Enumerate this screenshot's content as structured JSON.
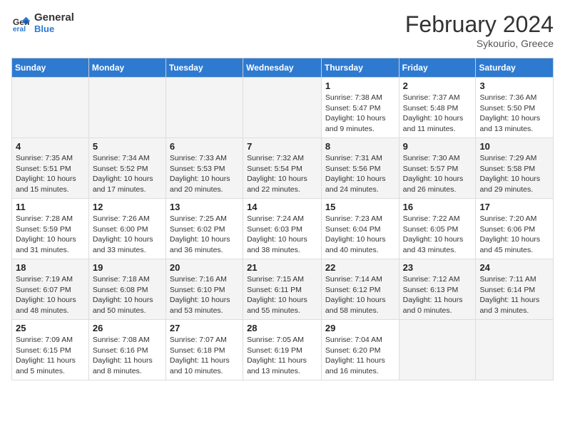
{
  "header": {
    "logo_line1": "General",
    "logo_line2": "Blue",
    "month_title": "February 2024",
    "subtitle": "Sykourio, Greece"
  },
  "days_of_week": [
    "Sunday",
    "Monday",
    "Tuesday",
    "Wednesday",
    "Thursday",
    "Friday",
    "Saturday"
  ],
  "weeks": [
    [
      {
        "day": "",
        "detail": ""
      },
      {
        "day": "",
        "detail": ""
      },
      {
        "day": "",
        "detail": ""
      },
      {
        "day": "",
        "detail": ""
      },
      {
        "day": "1",
        "detail": "Sunrise: 7:38 AM\nSunset: 5:47 PM\nDaylight: 10 hours\nand 9 minutes."
      },
      {
        "day": "2",
        "detail": "Sunrise: 7:37 AM\nSunset: 5:48 PM\nDaylight: 10 hours\nand 11 minutes."
      },
      {
        "day": "3",
        "detail": "Sunrise: 7:36 AM\nSunset: 5:50 PM\nDaylight: 10 hours\nand 13 minutes."
      }
    ],
    [
      {
        "day": "4",
        "detail": "Sunrise: 7:35 AM\nSunset: 5:51 PM\nDaylight: 10 hours\nand 15 minutes."
      },
      {
        "day": "5",
        "detail": "Sunrise: 7:34 AM\nSunset: 5:52 PM\nDaylight: 10 hours\nand 17 minutes."
      },
      {
        "day": "6",
        "detail": "Sunrise: 7:33 AM\nSunset: 5:53 PM\nDaylight: 10 hours\nand 20 minutes."
      },
      {
        "day": "7",
        "detail": "Sunrise: 7:32 AM\nSunset: 5:54 PM\nDaylight: 10 hours\nand 22 minutes."
      },
      {
        "day": "8",
        "detail": "Sunrise: 7:31 AM\nSunset: 5:56 PM\nDaylight: 10 hours\nand 24 minutes."
      },
      {
        "day": "9",
        "detail": "Sunrise: 7:30 AM\nSunset: 5:57 PM\nDaylight: 10 hours\nand 26 minutes."
      },
      {
        "day": "10",
        "detail": "Sunrise: 7:29 AM\nSunset: 5:58 PM\nDaylight: 10 hours\nand 29 minutes."
      }
    ],
    [
      {
        "day": "11",
        "detail": "Sunrise: 7:28 AM\nSunset: 5:59 PM\nDaylight: 10 hours\nand 31 minutes."
      },
      {
        "day": "12",
        "detail": "Sunrise: 7:26 AM\nSunset: 6:00 PM\nDaylight: 10 hours\nand 33 minutes."
      },
      {
        "day": "13",
        "detail": "Sunrise: 7:25 AM\nSunset: 6:02 PM\nDaylight: 10 hours\nand 36 minutes."
      },
      {
        "day": "14",
        "detail": "Sunrise: 7:24 AM\nSunset: 6:03 PM\nDaylight: 10 hours\nand 38 minutes."
      },
      {
        "day": "15",
        "detail": "Sunrise: 7:23 AM\nSunset: 6:04 PM\nDaylight: 10 hours\nand 40 minutes."
      },
      {
        "day": "16",
        "detail": "Sunrise: 7:22 AM\nSunset: 6:05 PM\nDaylight: 10 hours\nand 43 minutes."
      },
      {
        "day": "17",
        "detail": "Sunrise: 7:20 AM\nSunset: 6:06 PM\nDaylight: 10 hours\nand 45 minutes."
      }
    ],
    [
      {
        "day": "18",
        "detail": "Sunrise: 7:19 AM\nSunset: 6:07 PM\nDaylight: 10 hours\nand 48 minutes."
      },
      {
        "day": "19",
        "detail": "Sunrise: 7:18 AM\nSunset: 6:08 PM\nDaylight: 10 hours\nand 50 minutes."
      },
      {
        "day": "20",
        "detail": "Sunrise: 7:16 AM\nSunset: 6:10 PM\nDaylight: 10 hours\nand 53 minutes."
      },
      {
        "day": "21",
        "detail": "Sunrise: 7:15 AM\nSunset: 6:11 PM\nDaylight: 10 hours\nand 55 minutes."
      },
      {
        "day": "22",
        "detail": "Sunrise: 7:14 AM\nSunset: 6:12 PM\nDaylight: 10 hours\nand 58 minutes."
      },
      {
        "day": "23",
        "detail": "Sunrise: 7:12 AM\nSunset: 6:13 PM\nDaylight: 11 hours\nand 0 minutes."
      },
      {
        "day": "24",
        "detail": "Sunrise: 7:11 AM\nSunset: 6:14 PM\nDaylight: 11 hours\nand 3 minutes."
      }
    ],
    [
      {
        "day": "25",
        "detail": "Sunrise: 7:09 AM\nSunset: 6:15 PM\nDaylight: 11 hours\nand 5 minutes."
      },
      {
        "day": "26",
        "detail": "Sunrise: 7:08 AM\nSunset: 6:16 PM\nDaylight: 11 hours\nand 8 minutes."
      },
      {
        "day": "27",
        "detail": "Sunrise: 7:07 AM\nSunset: 6:18 PM\nDaylight: 11 hours\nand 10 minutes."
      },
      {
        "day": "28",
        "detail": "Sunrise: 7:05 AM\nSunset: 6:19 PM\nDaylight: 11 hours\nand 13 minutes."
      },
      {
        "day": "29",
        "detail": "Sunrise: 7:04 AM\nSunset: 6:20 PM\nDaylight: 11 hours\nand 16 minutes."
      },
      {
        "day": "",
        "detail": ""
      },
      {
        "day": "",
        "detail": ""
      }
    ]
  ]
}
